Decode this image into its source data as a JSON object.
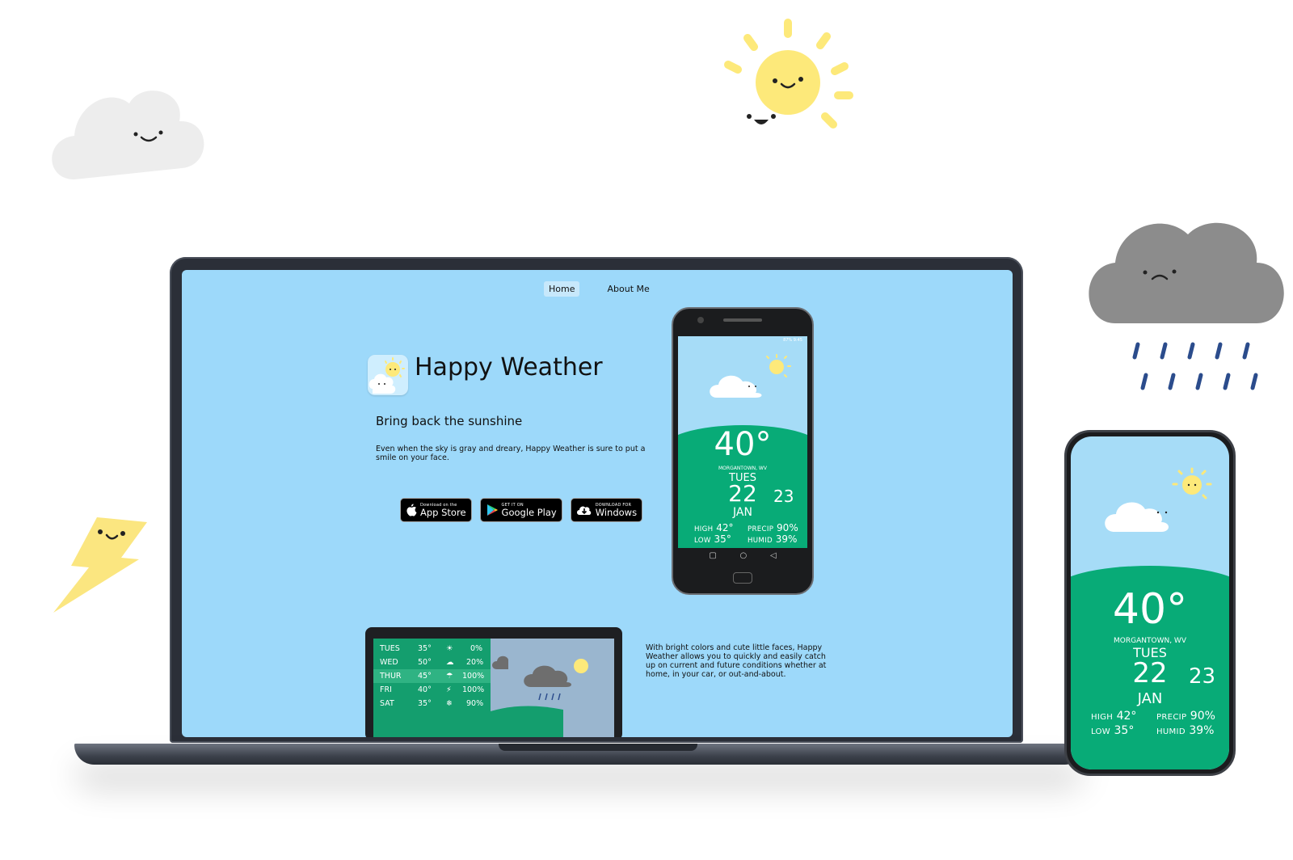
{
  "colors": {
    "sky": "#9dd9fa",
    "green": "#08ab77",
    "sun": "#fde97a",
    "cloud_light": "#ededed",
    "cloud_dark": "#8c8c8c",
    "rain": "#2b4c8c",
    "bolt": "#fbe680"
  },
  "site": {
    "nav": {
      "home": "Home",
      "about": "About Me"
    },
    "app_name": "Happy Weather",
    "tagline": "Bring back the sunshine",
    "intro": "Even when the sky is gray and dreary, Happy Weather is sure to put a smile on your face.",
    "stores": {
      "apple": {
        "small": "Download on the",
        "big": "App Store"
      },
      "google": {
        "small": "GET IT ON",
        "big": "Google Play"
      },
      "windows": {
        "small": "DOWNLOAD FOR",
        "big": "Windows"
      }
    },
    "feature": "With bright colors and cute little faces, Happy Weather allows you to quickly and easily catch up on current and future conditions whether at home, in your car, or out-and-about."
  },
  "phone": {
    "status": "87% 9:45",
    "temp": "40°",
    "location": "MORGANTOWN, WV",
    "day": "TUES",
    "date": "22",
    "next_date": "23",
    "month": "JAN",
    "high_label": "HIGH",
    "high": "42°",
    "low_label": "LOW",
    "low": "35°",
    "precip_label": "PRECIP",
    "precip": "90%",
    "humid_label": "HUMID",
    "humid": "39%"
  },
  "tablet": {
    "days": [
      {
        "day": "TUES",
        "temp": "35°",
        "icon": "sun-icon",
        "pct": "0%"
      },
      {
        "day": "WED",
        "temp": "50°",
        "icon": "cloud-icon",
        "pct": "20%"
      },
      {
        "day": "THUR",
        "temp": "45°",
        "icon": "rain-cloud-icon",
        "pct": "100%"
      },
      {
        "day": "FRI",
        "temp": "40°",
        "icon": "storm-icon",
        "pct": "100%"
      },
      {
        "day": "SAT",
        "temp": "35°",
        "icon": "snow-icon",
        "pct": "90%"
      }
    ]
  }
}
